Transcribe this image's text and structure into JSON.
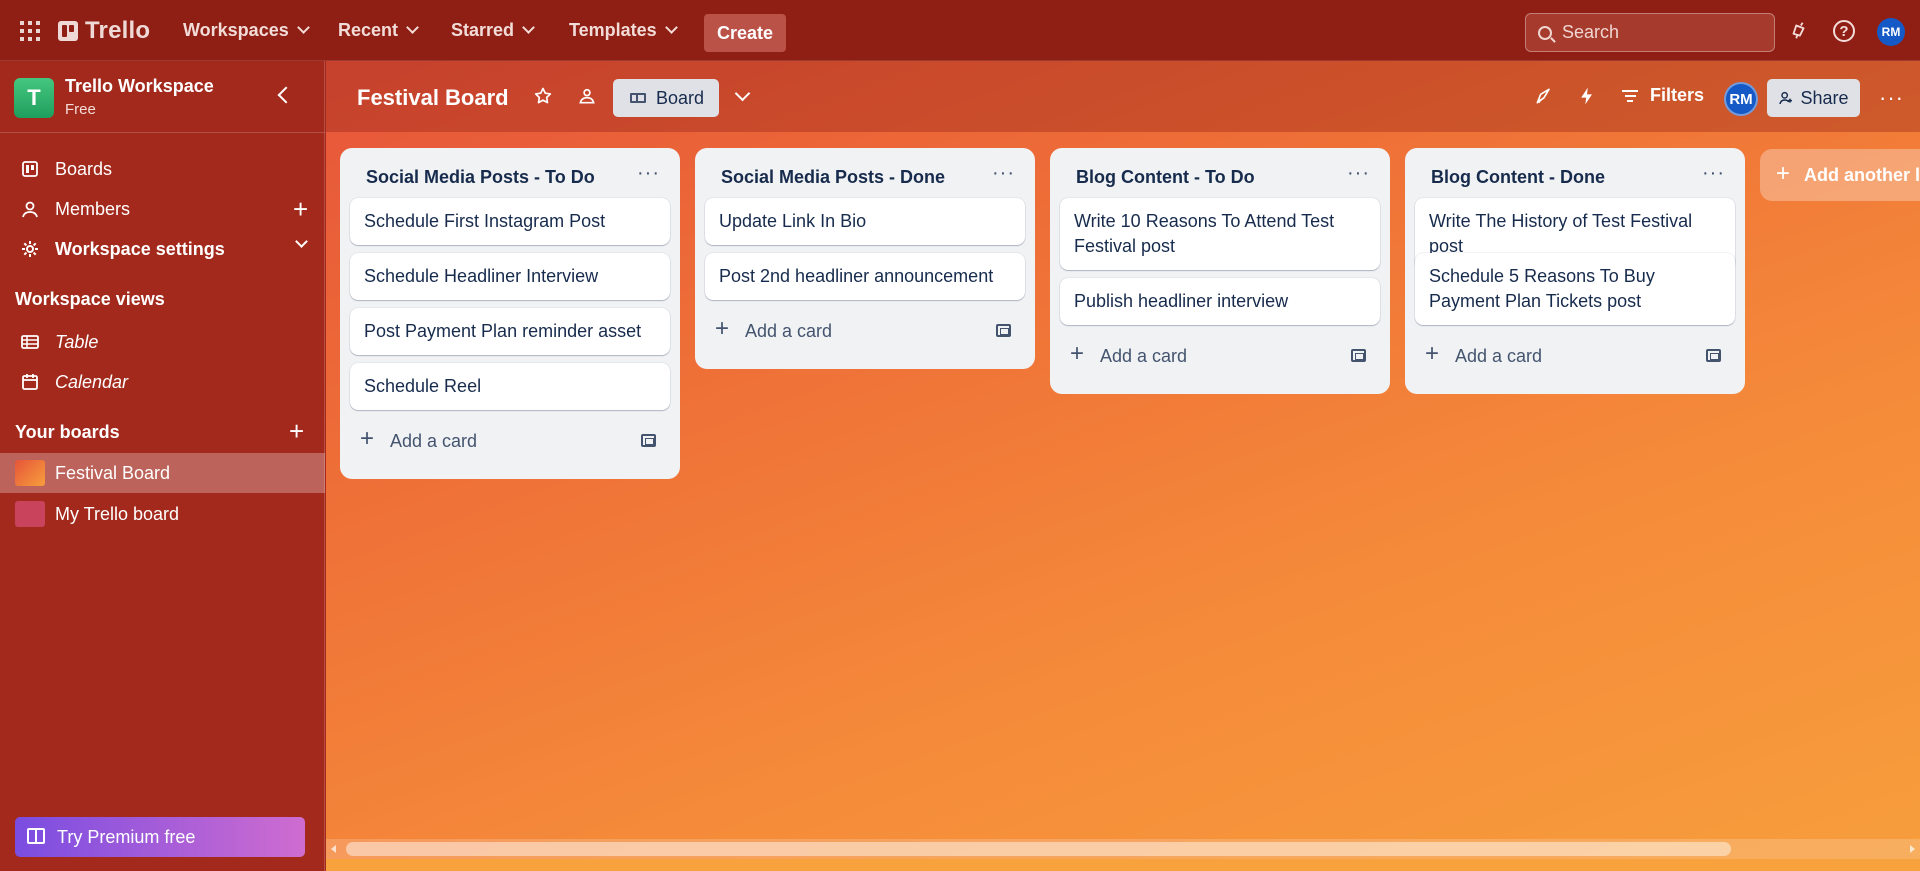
{
  "topnav": {
    "logo": "Trello",
    "menus": [
      {
        "label": "Workspaces"
      },
      {
        "label": "Recent"
      },
      {
        "label": "Starred"
      },
      {
        "label": "Templates"
      }
    ],
    "create_label": "Create",
    "search_placeholder": "Search",
    "avatar_initials": "RM"
  },
  "sidebar": {
    "workspace_initial": "T",
    "workspace_name": "Trello Workspace",
    "workspace_plan": "Free",
    "items": [
      {
        "label": "Boards"
      },
      {
        "label": "Members"
      },
      {
        "label": "Workspace settings"
      }
    ],
    "views_heading": "Workspace views",
    "views": [
      {
        "label": "Table"
      },
      {
        "label": "Calendar"
      }
    ],
    "your_boards_heading": "Your boards",
    "boards": [
      {
        "label": "Festival Board",
        "color": "#f06a3e",
        "active": true
      },
      {
        "label": "My Trello board",
        "color": "#c9435d",
        "active": false
      }
    ],
    "premium_label": "Try Premium free"
  },
  "board": {
    "title": "Festival Board",
    "view_label": "Board",
    "filters_label": "Filters",
    "member_initials": "RM",
    "share_label": "Share",
    "more_label": "···",
    "add_list_label": "Add another list",
    "add_card_label": "Add a card",
    "lists": [
      {
        "title": "Social Media Posts - To Do",
        "cards": [
          "Schedule First Instagram Post",
          "Schedule Headliner Interview",
          "Post Payment Plan reminder asset",
          "Schedule Reel"
        ]
      },
      {
        "title": "Social Media Posts - Done",
        "cards": [
          "Update Link In Bio",
          "Post 2nd headliner announcement"
        ]
      },
      {
        "title": "Blog Content - To Do",
        "cards": [
          "Write 10 Reasons To Attend Test Festival post",
          "Publish headliner interview"
        ]
      },
      {
        "title": "Blog Content - Done",
        "cards": [
          "Write The History of Test Festival post",
          "Schedule 5 Reasons To Buy Payment Plan Tickets post"
        ]
      }
    ]
  },
  "colors": {
    "nav_bg": "#8f1f14",
    "sidebar_bg": "#a3291c",
    "board_gradient_start": "#e6553a",
    "board_gradient_end": "#f79e3c",
    "list_bg": "#f1f2f4",
    "premium_gradient": "#7a4de1"
  }
}
